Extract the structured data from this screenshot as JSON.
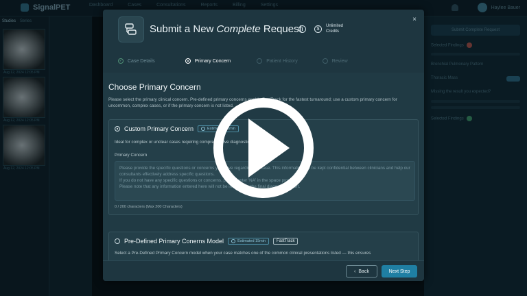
{
  "app": {
    "logo": "SignalPET",
    "nav": [
      "Dashboard",
      "Cases",
      "Consultations",
      "Reports",
      "Billing",
      "Settings"
    ],
    "user_name": "Haylee Bauer"
  },
  "left_panel": {
    "tabs": [
      "Studies",
      "Series"
    ],
    "thumb_caption": "Aug 12, 2024 12:05 PM"
  },
  "right_panel": {
    "button": "Submit Complete Request",
    "rows": [
      "Selected Findings",
      "Bronchial Pulmonary Pattern",
      "Thoracic Mass",
      "Missing the result you expected?",
      "Selected Findings"
    ]
  },
  "modal": {
    "title_prefix": "Submit a New ",
    "title_emphasis": "Complete",
    "title_suffix": " Request",
    "credits": "Unlimited Credits",
    "close_glyph": "×",
    "steps": [
      {
        "label": "Case Details",
        "state": "done"
      },
      {
        "label": "Primary Concern",
        "state": "active"
      },
      {
        "label": "Patient History",
        "state": "upcoming"
      },
      {
        "label": "Review",
        "state": "upcoming"
      }
    ],
    "section_title": "Choose Primary Concern",
    "section_desc": "Please select the primary clinical concern. Pre-defined primary concerns enable FastTrack for the fastest turnaround; use a custom primary concern for uncommon, complex cases, or if the primary concern is not listed.",
    "custom_option": {
      "title": "Custom Primary Concern",
      "badge": "Estimated 30min",
      "desc": "Ideal for complex or unclear cases requiring comprehensive diagnostic review.",
      "field_label": "Primary Concern",
      "placeholder": "Please provide the specific questions or concerns you have regarding the case. This information will be kept confidential between clinicians and help our consultants effectively address specific questions.\nIf you do not have any specific questions or concerns, please enter 'NA' in the space provided.\nPlease note that any information entered here will not be included in the final diagnostic report.",
      "char_count": "0 / 200 characters (Max 200 Characters)"
    },
    "predefined_option": {
      "title": "Pre-Defined Primary Conerns Model",
      "badge": "Estimated 15min",
      "fast_badge": "FastTrack",
      "desc": "Select a Pre-Defined Primary Concern model when your case matches one of the common clinical presentations listed — this ensures"
    },
    "back_label": "Back",
    "next_label": "Next Step"
  },
  "colors": {
    "accent": "#1f7fa3",
    "modal_bg": "#1e3640",
    "play_overlay": "#ffffff"
  }
}
